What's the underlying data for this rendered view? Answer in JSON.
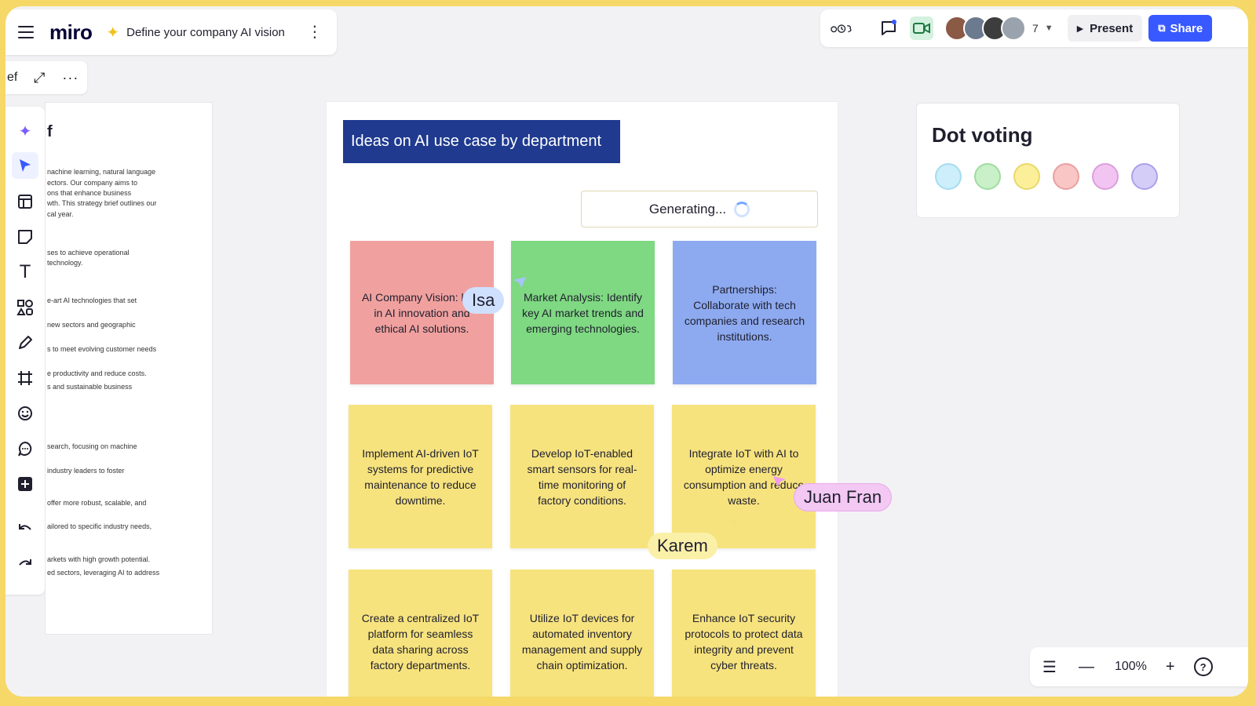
{
  "app": {
    "name": "miro",
    "board_title": "Define your company AI vision"
  },
  "topbar": {
    "participant_count": "7",
    "present_label": "Present",
    "share_label": "Share"
  },
  "minibar": {
    "fragment": "ef"
  },
  "doc": {
    "heading": "f",
    "lines": [
      "nachine learning, natural language",
      "ectors. Our company aims to",
      "ons that enhance business",
      "wth. This strategy brief outlines our",
      "cal year.",
      "ses to achieve operational",
      "technology.",
      "e-art AI technologies that set",
      "new sectors and geographic",
      "s to meet evolving customer needs",
      "e productivity and reduce costs.",
      "s and sustainable business",
      "search, focusing on machine",
      "industry leaders to foster",
      "offer more robust, scalable, and",
      "ailored to specific industry needs,",
      "arkets with high growth potential.",
      "ed sectors, leveraging AI to address"
    ]
  },
  "frame": {
    "title": "Ideas on AI use case by department",
    "generating": "Generating..."
  },
  "stickies": [
    {
      "text": "AI Company Vision: lead in AI innovation and ethical AI solutions.",
      "color": "#f0a19f"
    },
    {
      "text": "Market Analysis: Identify key AI market trends and emerging technologies.",
      "color": "#7fd882"
    },
    {
      "text": "Partnerships: Collaborate with tech companies and research institutions.",
      "color": "#8daaf0"
    },
    {
      "text": "Implement AI-driven IoT systems for predictive maintenance to reduce downtime.",
      "color": "#f7e37e"
    },
    {
      "text": "Develop IoT-enabled smart sensors for real-time monitoring of factory conditions.",
      "color": "#f7e37e"
    },
    {
      "text": "Integrate IoT with AI to optimize energy consumption and reduce waste.",
      "color": "#f7e37e"
    },
    {
      "text": "Create a centralized IoT platform for seamless data sharing across factory departments.",
      "color": "#f7e37e"
    },
    {
      "text": "Utilize IoT devices for automated inventory management and supply chain optimization.",
      "color": "#f7e37e"
    },
    {
      "text": "Enhance IoT security protocols to protect data integrity and prevent cyber threats.",
      "color": "#f7e37e"
    }
  ],
  "dot_voting": {
    "title": "Dot voting",
    "dots": [
      "#cdeefb",
      "#c9f0c9",
      "#fbef9a",
      "#f9c5c5",
      "#f2c4f2",
      "#d4cdf8"
    ]
  },
  "cursors": [
    {
      "name": "Isa",
      "color": "#cfe0ff"
    },
    {
      "name": "Juan Fran",
      "color": "#f3c8f3"
    },
    {
      "name": "Karem",
      "color": "#fbf0a8"
    }
  ],
  "zoom": {
    "level": "100%"
  }
}
